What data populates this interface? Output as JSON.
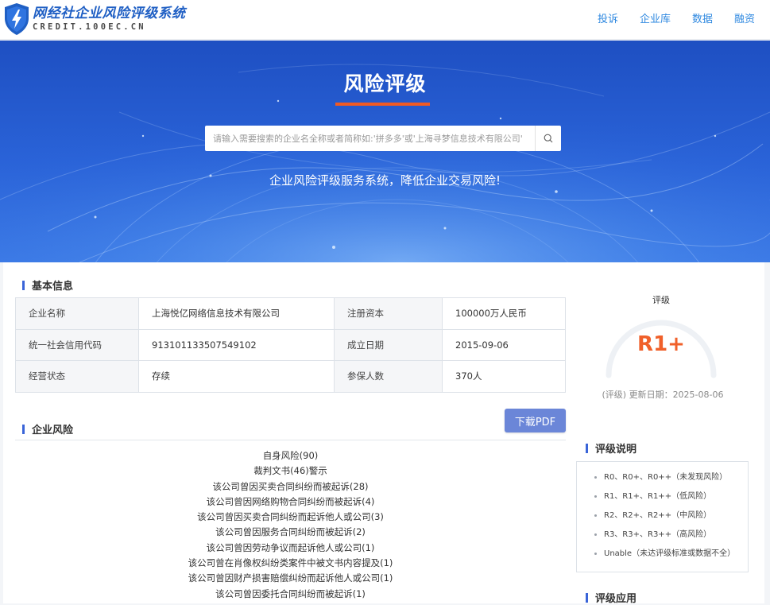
{
  "header": {
    "logo_cn": "网经社企业风险评级系统",
    "logo_en": "CREDIT.100EC.CN",
    "nav": [
      "投诉",
      "企业库",
      "数据",
      "融资"
    ]
  },
  "hero": {
    "title": "风险评级",
    "search_placeholder": "请输入需要搜索的企业名全称或者简称如:'拼多多'或'上海寻梦信息技术有限公司'",
    "subtitle": "企业风险评级服务系统，降低企业交易风险!"
  },
  "basic_info": {
    "title": "基本信息",
    "rows": [
      [
        "企业名称",
        "上海悦亿网络信息技术有限公司",
        "注册资本",
        "100000万人民币"
      ],
      [
        "统一社会信用代码",
        "913101133507549102",
        "成立日期",
        "2015-09-06"
      ],
      [
        "经营状态",
        "存续",
        "参保人数",
        "370人"
      ]
    ]
  },
  "enterprise_risk": {
    "title": "企业风险",
    "download_label": "下载PDF",
    "items": [
      "自身风险(90)",
      "裁判文书(46)警示",
      "该公司曾因买卖合同纠纷而被起诉(28)",
      "该公司曾因网络购物合同纠纷而被起诉(4)",
      "该公司曾因买卖合同纠纷而起诉他人或公司(3)",
      "该公司曾因服务合同纠纷而被起诉(2)",
      "该公司曾因劳动争议而起诉他人或公司(1)",
      "该公司曾在肖像权纠纷类案件中被文书内容提及(1)",
      "该公司曾因财产损害赔偿纠纷而起诉他人或公司(1)",
      "该公司曾因委托合同纠纷而被起诉(1)"
    ]
  },
  "rating": {
    "label": "评级",
    "value": "R1+",
    "value_color": "#f0602a",
    "update_text": "(评级) 更新日期：2025-08-06"
  },
  "rating_explanation": {
    "title": "评级说明",
    "items": [
      "R0、R0+、R0++（未发现风险）",
      "R1、R1+、R1++（低风险）",
      "R2、R2+、R2++（中风险）",
      "R3、R3+、R3++（高风险）",
      "Unable（未达评级标准或数据不全）"
    ]
  },
  "rating_application": {
    "title": "评级应用"
  }
}
